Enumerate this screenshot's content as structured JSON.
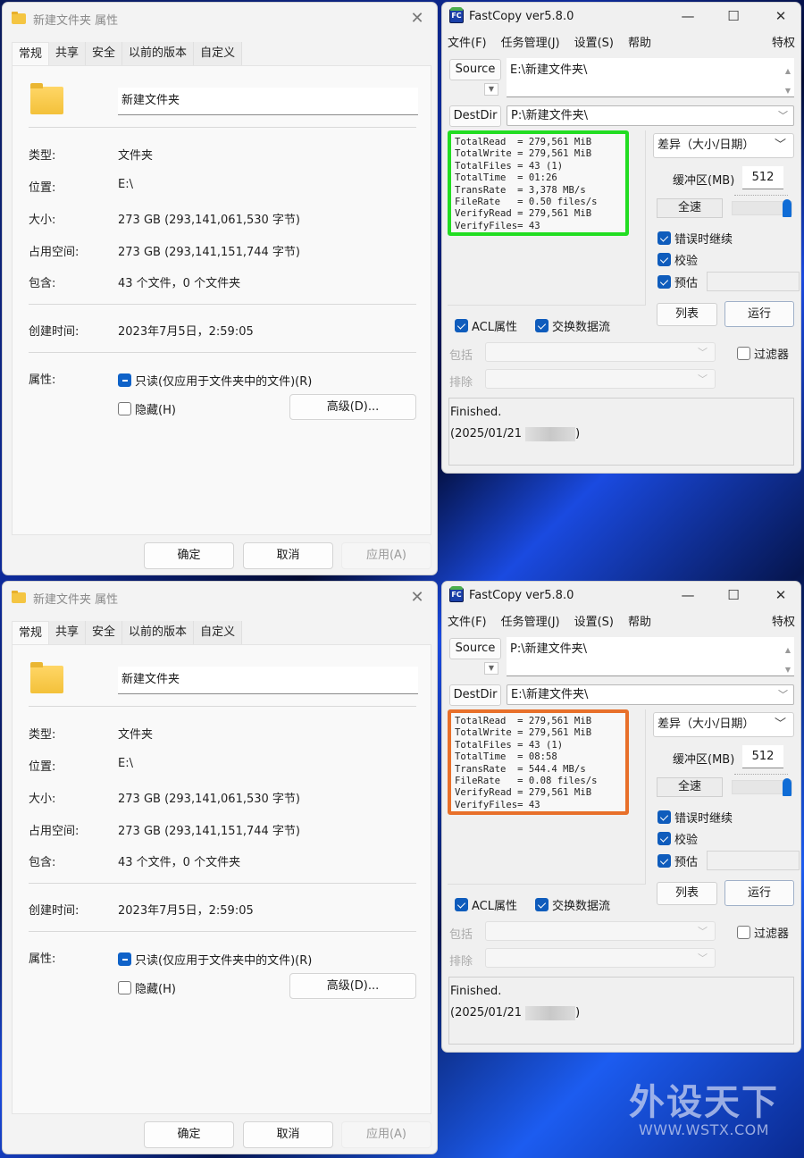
{
  "shared": {
    "props": {
      "title": "新建文件夹 属性",
      "tabs": [
        "常规",
        "共享",
        "安全",
        "以前的版本",
        "自定义"
      ],
      "folder_name": "新建文件夹",
      "rows": [
        {
          "label": "类型:",
          "value": "文件夹"
        },
        {
          "label": "位置:",
          "value": "E:\\"
        },
        {
          "label": "大小:",
          "value": "273 GB (293,141,061,530 字节)"
        },
        {
          "label": "占用空间:",
          "value": "273 GB (293,141,151,744 字节)"
        },
        {
          "label": "包含:",
          "value": "43 个文件，0 个文件夹"
        }
      ],
      "created_label": "创建时间:",
      "created_value": "2023年7月5日，2:59:05",
      "attr_label": "属性:",
      "readonly_label": "只读(仅应用于文件夹中的文件)(R)",
      "hidden_label": "隐藏(H)",
      "advanced_label": "高级(D)...",
      "ok_label": "确定",
      "cancel_label": "取消",
      "apply_label": "应用(A)"
    },
    "fc": {
      "title": "FastCopy ver5.8.0",
      "icon_text": "FC",
      "menu": [
        "文件(F)",
        "任务管理(J)",
        "设置(S)",
        "帮助",
        "特权"
      ],
      "source_label": "Source",
      "destdir_label": "DestDir",
      "mode": "差异（大小/日期）",
      "buffer_label": "缓冲区(MB)",
      "buffer_value": "512",
      "speed_label": "全速",
      "speed_level": 1.0,
      "options": [
        {
          "label": "错误时继续",
          "checked": true
        },
        {
          "label": "校验",
          "checked": true
        },
        {
          "label": "预估",
          "checked": true
        }
      ],
      "list_label": "列表",
      "run_label": "运行",
      "acl_label": "ACL属性",
      "acl_checked": true,
      "stream_label": "交换数据流",
      "stream_checked": true,
      "include_label": "包括",
      "exclude_label": "排除",
      "filter_label": "过滤器",
      "filter_checked": false,
      "status_line1": "Finished.",
      "status_line2_prefix": " (2025/01/21",
      "status_line2_suffix": ")"
    }
  },
  "top": {
    "source_path": "E:\\新建文件夹\\",
    "dest_path": "P:\\新建文件夹\\",
    "highlight_color": "#22dd22",
    "stats": [
      "TotalRead  = 279,561 MiB",
      "TotalWrite = 279,561 MiB",
      "TotalFiles = 43 (1)",
      "TotalTime  = 01:26",
      "TransRate  = 3,378 MB/s",
      "FileRate   = 0.50 files/s",
      "VerifyRead = 279,561 MiB",
      "VerifyFiles= 43"
    ]
  },
  "bottom": {
    "source_path": "P:\\新建文件夹\\",
    "dest_path": "E:\\新建文件夹\\",
    "highlight_color": "#e8702a",
    "stats": [
      "TotalRead  = 279,561 MiB",
      "TotalWrite = 279,561 MiB",
      "TotalFiles = 43 (1)",
      "TotalTime  = 08:58",
      "TransRate  = 544.4 MB/s",
      "FileRate   = 0.08 files/s",
      "VerifyRead = 279,561 MiB",
      "VerifyFiles= 43"
    ]
  },
  "watermark": {
    "cn": "外设天下",
    "en": "WWW.WSTX.COM"
  }
}
